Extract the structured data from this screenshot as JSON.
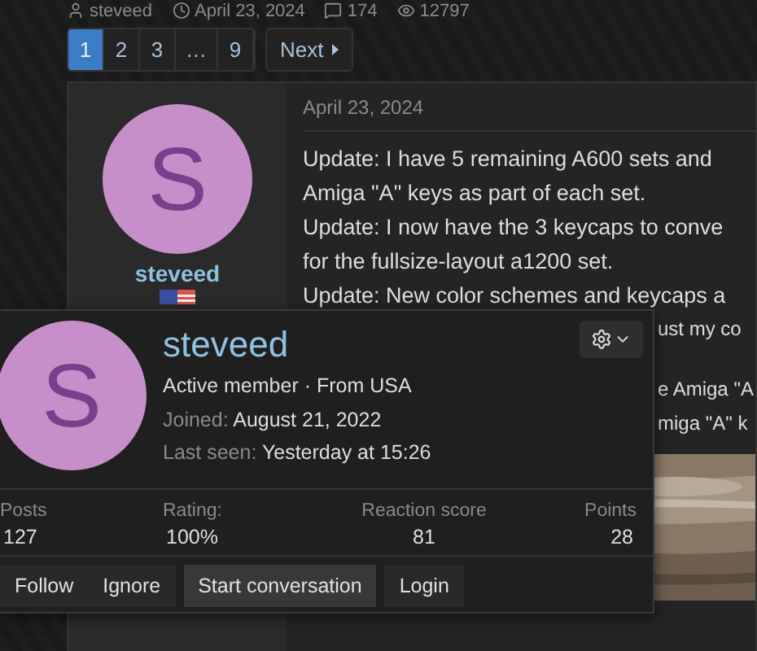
{
  "thread_meta": [
    {
      "kind": "user",
      "text": "steveed"
    },
    {
      "kind": "date",
      "text": "April 23, 2024"
    },
    {
      "kind": "replies",
      "text": "174"
    },
    {
      "kind": "views",
      "text": "12797"
    }
  ],
  "pagination": {
    "pages": [
      {
        "label": "1",
        "selected": true
      },
      {
        "label": "2",
        "selected": false
      },
      {
        "label": "3",
        "selected": false
      },
      {
        "label": "…",
        "selected": false
      },
      {
        "label": "9",
        "selected": false
      }
    ],
    "next": "Next"
  },
  "post": {
    "author": {
      "initial": "S",
      "name": "steveed"
    },
    "date": "April 23, 2024",
    "lines": [
      {
        "kind": "full",
        "text": "Update: I have 5 remaining A600 sets and"
      },
      {
        "kind": "full",
        "text": "Amiga \"A\" keys as part of each set."
      },
      {
        "kind": "full",
        "text": "Update: I now have the 3 keycaps to conve"
      },
      {
        "kind": "full",
        "text": "for the fullsize-layout a1200 set."
      },
      {
        "kind": "full",
        "text": "Update: New color schemes and keycaps a"
      },
      {
        "kind": "fragment",
        "text": "ust my co"
      },
      {
        "kind": "spaced",
        "text": "e Amiga \"A"
      },
      {
        "kind": "fragment",
        "text": "miga \"A\" k"
      }
    ]
  },
  "member_card": {
    "initial": "S",
    "name": "steveed",
    "subtitle": "Active member · From USA",
    "info": [
      {
        "label": "Joined:",
        "value": "August 21, 2022"
      },
      {
        "label": "Last seen:",
        "value": "Yesterday at 15:26"
      }
    ],
    "stats": [
      {
        "label": "Posts",
        "value": "127"
      },
      {
        "label": "Rating:",
        "value": "100%"
      },
      {
        "label": "Reaction score",
        "value": "81"
      },
      {
        "label": "Points",
        "value": "28"
      }
    ],
    "action_groups": [
      [
        {
          "label": "Follow",
          "highlight": false
        },
        {
          "label": "Ignore",
          "highlight": false
        }
      ],
      [
        {
          "label": "Start conversation",
          "highlight": true
        }
      ],
      [
        {
          "label": "Login",
          "highlight": false
        }
      ]
    ]
  }
}
